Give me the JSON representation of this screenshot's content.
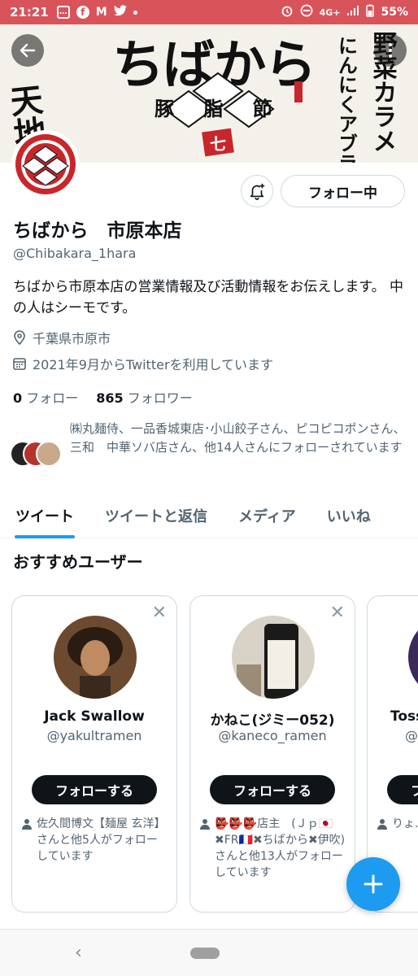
{
  "status_bar": {
    "time": "21:21",
    "network": "4G+",
    "battery": "55%"
  },
  "banner": {
    "text_main": "ちばから",
    "text_left": "天地返し",
    "text_right_1": "野菜カラメ",
    "text_right_2": "にんにくアブラ",
    "text_center": "豚 脂 節",
    "text_badge": "七"
  },
  "profile": {
    "display_name": "ちばから　市原本店",
    "handle": "@Chibakara_1hara",
    "bio": "ちばから市原本店の営業情報及び活動情報をお伝えします。 中の人はシーモです。",
    "location": "千葉県市原市",
    "joined": "2021年9月からTwitterを利用しています",
    "following_count": "0",
    "following_label": "フォロー",
    "followers_count": "865",
    "followers_label": "フォロワー",
    "following_button": "フォロー中",
    "followed_by": "㈱丸麺侍、一品香城東店･小山餃子さん、ピコピコポンさん、三和　中華ソバ店さん、他14人さんにフォローされています"
  },
  "tabs": [
    {
      "label": "ツイート"
    },
    {
      "label": "ツイートと返信"
    },
    {
      "label": "メディア"
    },
    {
      "label": "いいね"
    }
  ],
  "suggestions": {
    "title": "おすすめユーザー",
    "follow_label": "フォローする",
    "cards": [
      {
        "name": "Jack Swallow",
        "handle": "@yakultramen",
        "social": "佐久間博文【麺屋 玄洋】さんと他5人がフォローしています"
      },
      {
        "name": "かねこ(ジミー052)",
        "handle": "@kaneco_ramen",
        "social": "👺👺👺店主　(Ｊｐ🇯🇵✖FR🇫🇷✖ちばから✖伊吹) さんと他13人がフォローしています"
      },
      {
        "name": "Toss",
        "handle": "@",
        "social": "りょ...人が...ます"
      }
    ]
  },
  "colors": {
    "status_bar": "#d9535a",
    "accent": "#1d9bf0",
    "text_primary": "#0f1419",
    "text_secondary": "#536471"
  }
}
